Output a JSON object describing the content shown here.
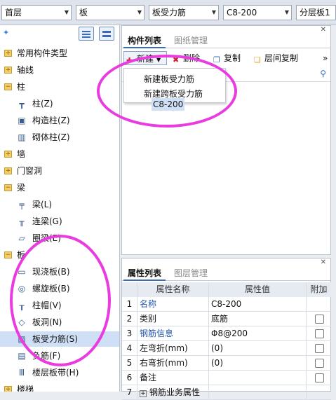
{
  "toolbar": {
    "floor": "首层",
    "category": "板",
    "type": "板受力筋",
    "spec": "C8-200",
    "layer": "分层板1"
  },
  "tree": {
    "groups": [
      "常用构件类型",
      "轴线",
      "柱",
      "墙",
      "门窗洞",
      "梁",
      "板",
      "楼梯"
    ],
    "columns": [
      "柱(Z)",
      "构造柱(Z)",
      "砌体柱(Z)"
    ],
    "beams": [
      "梁(L)",
      "连梁(G)",
      "圈梁(E)"
    ],
    "slabs": [
      "现浇板(B)",
      "螺旋板(B)",
      "柱帽(V)",
      "板洞(N)",
      "板受力筋(S)",
      "负筋(F)",
      "楼层板带(H)"
    ]
  },
  "components": {
    "tab_active": "构件列表",
    "tab_inactive": "图纸管理",
    "new_label": "新建",
    "delete_label": "删除",
    "copy_label": "复制",
    "floor_copy_label": "层间复制",
    "more": "»",
    "dropdown": [
      "新建板受力筋",
      "新建跨板受力筋"
    ],
    "item": "C8-200"
  },
  "properties": {
    "tab_active": "属性列表",
    "tab_inactive": "图层管理",
    "headers": [
      "",
      "属性名称",
      "属性值",
      "附加"
    ],
    "rows": [
      {
        "no": "1",
        "name": "名称",
        "value": "C8-200"
      },
      {
        "no": "2",
        "name": "类别",
        "value": "底筋"
      },
      {
        "no": "3",
        "name": "钢筋信息",
        "value": "Φ8@200"
      },
      {
        "no": "4",
        "name": "左弯折(mm)",
        "value": "(0)"
      },
      {
        "no": "5",
        "name": "右弯折(mm)",
        "value": "(0)"
      },
      {
        "no": "6",
        "name": "备注",
        "value": ""
      },
      {
        "no": "7",
        "name": "钢筋业务属性",
        "value": ""
      }
    ]
  },
  "colors": {
    "accent": "#3a6bb8",
    "annotation": "#e93be0",
    "selected": "#cfe0f6"
  }
}
